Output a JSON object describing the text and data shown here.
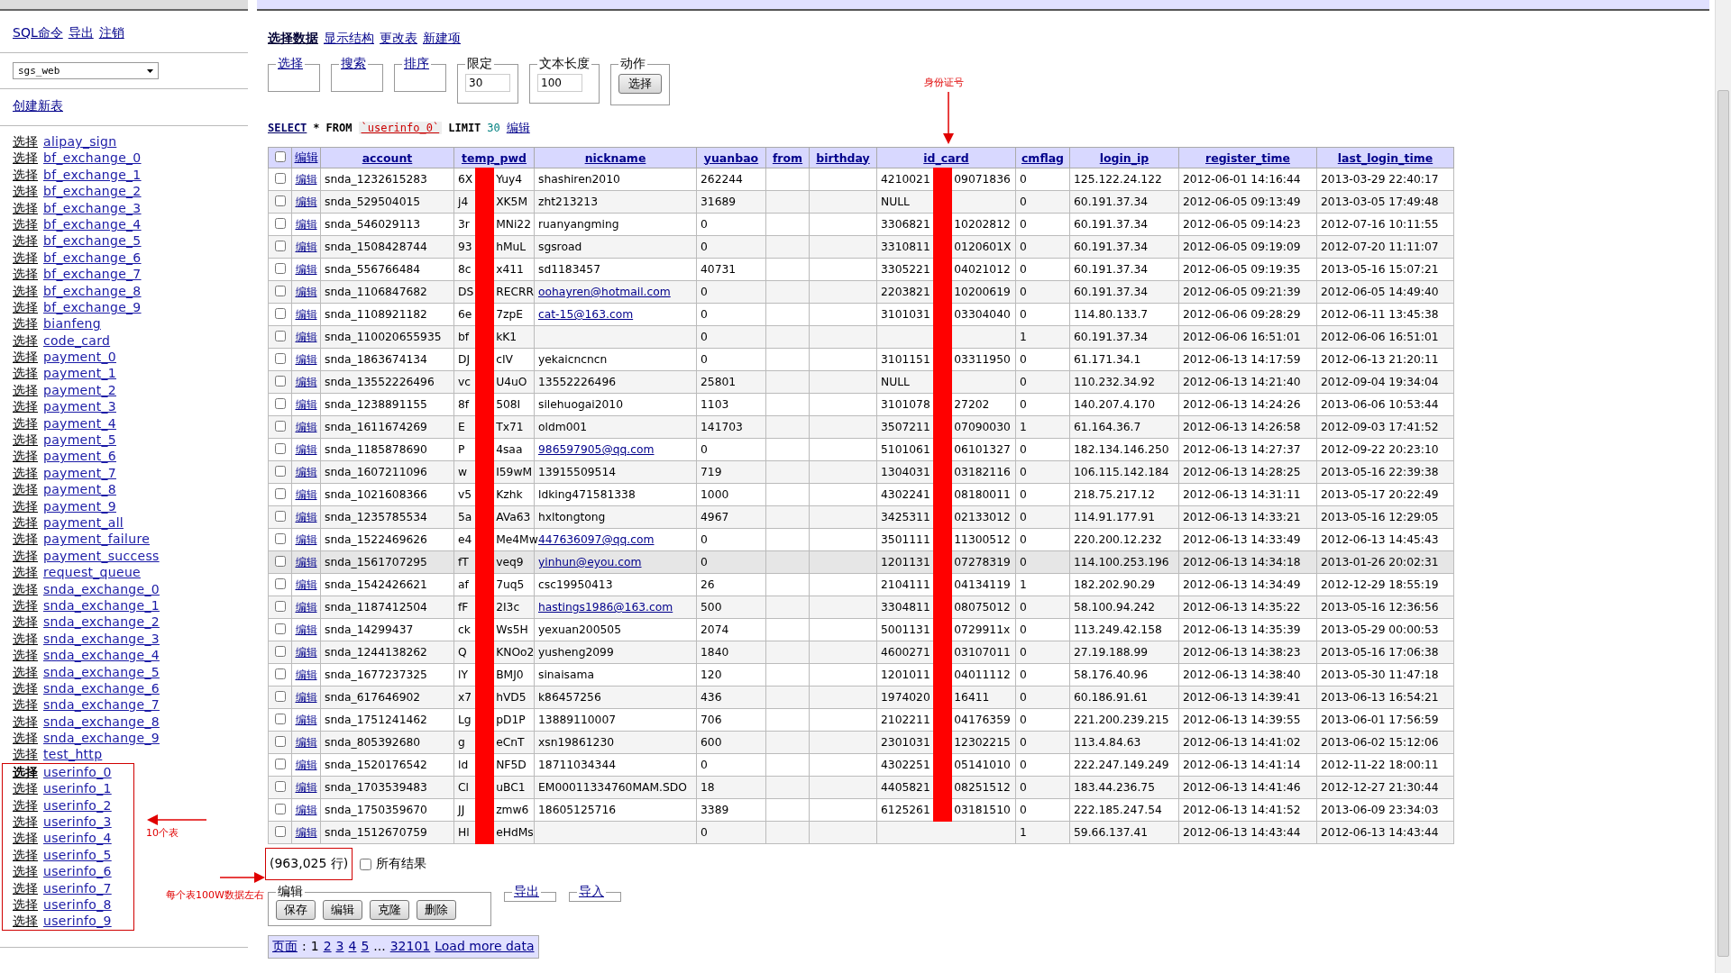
{
  "sidebar": {
    "top_links": [
      "SQL命令",
      "导出",
      "注销"
    ],
    "database": "sgs_web",
    "create_table": "创建新表",
    "items": [
      {
        "action": "选择",
        "name": "alipay_sign",
        "selected": false,
        "boxed": false
      },
      {
        "action": "选择",
        "name": "bf_exchange_0",
        "selected": false,
        "boxed": false
      },
      {
        "action": "选择",
        "name": "bf_exchange_1",
        "selected": false,
        "boxed": false
      },
      {
        "action": "选择",
        "name": "bf_exchange_2",
        "selected": false,
        "boxed": false
      },
      {
        "action": "选择",
        "name": "bf_exchange_3",
        "selected": false,
        "boxed": false
      },
      {
        "action": "选择",
        "name": "bf_exchange_4",
        "selected": false,
        "boxed": false
      },
      {
        "action": "选择",
        "name": "bf_exchange_5",
        "selected": false,
        "boxed": false
      },
      {
        "action": "选择",
        "name": "bf_exchange_6",
        "selected": false,
        "boxed": false
      },
      {
        "action": "选择",
        "name": "bf_exchange_7",
        "selected": false,
        "boxed": false
      },
      {
        "action": "选择",
        "name": "bf_exchange_8",
        "selected": false,
        "boxed": false
      },
      {
        "action": "选择",
        "name": "bf_exchange_9",
        "selected": false,
        "boxed": false
      },
      {
        "action": "选择",
        "name": "bianfeng",
        "selected": false,
        "boxed": false
      },
      {
        "action": "选择",
        "name": "code_card",
        "selected": false,
        "boxed": false
      },
      {
        "action": "选择",
        "name": "payment_0",
        "selected": false,
        "boxed": false
      },
      {
        "action": "选择",
        "name": "payment_1",
        "selected": false,
        "boxed": false
      },
      {
        "action": "选择",
        "name": "payment_2",
        "selected": false,
        "boxed": false
      },
      {
        "action": "选择",
        "name": "payment_3",
        "selected": false,
        "boxed": false
      },
      {
        "action": "选择",
        "name": "payment_4",
        "selected": false,
        "boxed": false
      },
      {
        "action": "选择",
        "name": "payment_5",
        "selected": false,
        "boxed": false
      },
      {
        "action": "选择",
        "name": "payment_6",
        "selected": false,
        "boxed": false
      },
      {
        "action": "选择",
        "name": "payment_7",
        "selected": false,
        "boxed": false
      },
      {
        "action": "选择",
        "name": "payment_8",
        "selected": false,
        "boxed": false
      },
      {
        "action": "选择",
        "name": "payment_9",
        "selected": false,
        "boxed": false
      },
      {
        "action": "选择",
        "name": "payment_all",
        "selected": false,
        "boxed": false
      },
      {
        "action": "选择",
        "name": "payment_failure",
        "selected": false,
        "boxed": false
      },
      {
        "action": "选择",
        "name": "payment_success",
        "selected": false,
        "boxed": false
      },
      {
        "action": "选择",
        "name": "request_queue",
        "selected": false,
        "boxed": false
      },
      {
        "action": "选择",
        "name": "snda_exchange_0",
        "selected": false,
        "boxed": false
      },
      {
        "action": "选择",
        "name": "snda_exchange_1",
        "selected": false,
        "boxed": false
      },
      {
        "action": "选择",
        "name": "snda_exchange_2",
        "selected": false,
        "boxed": false
      },
      {
        "action": "选择",
        "name": "snda_exchange_3",
        "selected": false,
        "boxed": false
      },
      {
        "action": "选择",
        "name": "snda_exchange_4",
        "selected": false,
        "boxed": false
      },
      {
        "action": "选择",
        "name": "snda_exchange_5",
        "selected": false,
        "boxed": false
      },
      {
        "action": "选择",
        "name": "snda_exchange_6",
        "selected": false,
        "boxed": false
      },
      {
        "action": "选择",
        "name": "snda_exchange_7",
        "selected": false,
        "boxed": false
      },
      {
        "action": "选择",
        "name": "snda_exchange_8",
        "selected": false,
        "boxed": false
      },
      {
        "action": "选择",
        "name": "snda_exchange_9",
        "selected": false,
        "boxed": false
      },
      {
        "action": "选择",
        "name": "test_http",
        "selected": false,
        "boxed": false
      },
      {
        "action": "选择",
        "name": "userinfo_0",
        "selected": true,
        "boxed": true
      },
      {
        "action": "选择",
        "name": "userinfo_1",
        "selected": false,
        "boxed": true
      },
      {
        "action": "选择",
        "name": "userinfo_2",
        "selected": false,
        "boxed": true
      },
      {
        "action": "选择",
        "name": "userinfo_3",
        "selected": false,
        "boxed": true
      },
      {
        "action": "选择",
        "name": "userinfo_4",
        "selected": false,
        "boxed": true
      },
      {
        "action": "选择",
        "name": "userinfo_5",
        "selected": false,
        "boxed": true
      },
      {
        "action": "选择",
        "name": "userinfo_6",
        "selected": false,
        "boxed": true
      },
      {
        "action": "选择",
        "name": "userinfo_7",
        "selected": false,
        "boxed": true
      },
      {
        "action": "选择",
        "name": "userinfo_8",
        "selected": false,
        "boxed": true
      },
      {
        "action": "选择",
        "name": "userinfo_9",
        "selected": false,
        "boxed": true
      }
    ]
  },
  "tabs": [
    {
      "label": "选择数据",
      "selected": true
    },
    {
      "label": "显示结构",
      "selected": false
    },
    {
      "label": "更改表",
      "selected": false
    },
    {
      "label": "新建项",
      "selected": false
    }
  ],
  "option_groups": [
    {
      "kind": "link",
      "legend": "选择"
    },
    {
      "kind": "link",
      "legend": "搜索"
    },
    {
      "kind": "link",
      "legend": "排序"
    },
    {
      "kind": "input",
      "legend": "限定",
      "value": "30"
    },
    {
      "kind": "input",
      "legend": "文本长度",
      "value": "100"
    },
    {
      "kind": "button",
      "legend": "动作",
      "button": "选择"
    }
  ],
  "sql": {
    "parts": [
      {
        "kind": "command",
        "text": "SELECT"
      },
      {
        "kind": "keyword",
        "text": "*"
      },
      {
        "kind": "keyword",
        "text": "FROM"
      },
      {
        "kind": "table",
        "text": "`userinfo_0`"
      },
      {
        "kind": "keyword",
        "text": "LIMIT"
      },
      {
        "kind": "number",
        "text": "30"
      }
    ],
    "edit": "编辑"
  },
  "table": {
    "select_all": {
      "checked": false
    },
    "edit_header": "编辑",
    "columns": [
      {
        "name": "account"
      },
      {
        "name": "temp_pwd"
      },
      {
        "name": "nickname"
      },
      {
        "name": "yuanbao"
      },
      {
        "name": "from"
      },
      {
        "name": "birthday"
      },
      {
        "name": "id_card"
      },
      {
        "name": "cmflag"
      },
      {
        "name": "login_ip"
      },
      {
        "name": "register_time"
      },
      {
        "name": "last_login_time"
      }
    ],
    "rows": [
      {
        "checked": false,
        "highlighted": false,
        "edit": "编辑",
        "cells": [
          "snda_1232615283",
          {
            "kind": "masked",
            "start": "6X",
            "end": "Yuy4"
          },
          "shashiren2010",
          "262244",
          null,
          null,
          {
            "kind": "masked",
            "start": "4210021",
            "end": "09071836"
          },
          "0",
          "125.122.24.122",
          "2012-06-01 14:16:44",
          "2013-03-29 22:40:17"
        ]
      },
      {
        "checked": false,
        "highlighted": false,
        "edit": "编辑",
        "cells": [
          "snda_529504015",
          {
            "kind": "masked",
            "start": "j4",
            "end": "XK5M"
          },
          "zht213213",
          "31689",
          null,
          null,
          {
            "kind": "masked",
            "start": "NULL"
          },
          "0",
          "60.191.37.34",
          "2012-06-05 09:13:49",
          "2013-03-05 17:49:48"
        ]
      },
      {
        "checked": false,
        "highlighted": false,
        "edit": "编辑",
        "cells": [
          "snda_546029113",
          {
            "kind": "masked",
            "start": "3r",
            "end": "MNi22"
          },
          "ruanyangming",
          "0",
          null,
          null,
          {
            "kind": "masked",
            "start": "3306821",
            "end": "10202812"
          },
          "0",
          "60.191.37.34",
          "2012-06-05 09:14:23",
          "2012-07-16 10:11:55"
        ]
      },
      {
        "checked": false,
        "highlighted": false,
        "edit": "编辑",
        "cells": [
          "snda_1508428744",
          {
            "kind": "masked",
            "start": "93",
            "end": "hMuL"
          },
          "sgsroad",
          "0",
          null,
          null,
          {
            "kind": "masked",
            "start": "3310811",
            "end": "0120601X"
          },
          "0",
          "60.191.37.34",
          "2012-06-05 09:19:09",
          "2012-07-20 11:11:07"
        ]
      },
      {
        "checked": false,
        "highlighted": false,
        "edit": "编辑",
        "cells": [
          "snda_556766484",
          {
            "kind": "masked",
            "start": "8c",
            "end": "x411"
          },
          "sd1183457",
          "40731",
          null,
          null,
          {
            "kind": "masked",
            "start": "3305221",
            "end": "04021012"
          },
          "0",
          "60.191.37.34",
          "2012-06-05 09:19:35",
          "2013-05-16 15:07:21"
        ]
      },
      {
        "checked": false,
        "highlighted": false,
        "edit": "编辑",
        "cells": [
          "snda_1106847682",
          {
            "kind": "masked",
            "start": "DS",
            "end": "RECRR"
          },
          {
            "kind": "link",
            "text": "oohayren@hotmail.com"
          },
          "0",
          null,
          null,
          {
            "kind": "masked",
            "start": "2203821",
            "end": "10200619"
          },
          "0",
          "60.191.37.34",
          "2012-06-05 09:21:39",
          "2012-06-05 14:49:40"
        ]
      },
      {
        "checked": false,
        "highlighted": false,
        "edit": "编辑",
        "cells": [
          "snda_1108921182",
          {
            "kind": "masked",
            "start": "6e",
            "end": "7zpE"
          },
          {
            "kind": "link",
            "text": "cat-15@163.com"
          },
          "0",
          null,
          null,
          {
            "kind": "masked",
            "start": "3101031",
            "end": "03304040"
          },
          "0",
          "114.80.133.7",
          "2012-06-06 09:28:29",
          "2012-06-11 13:45:38"
        ]
      },
      {
        "checked": false,
        "highlighted": false,
        "edit": "编辑",
        "cells": [
          "snda_110020655935",
          {
            "kind": "masked",
            "start": "bf",
            "end": "kK1"
          },
          null,
          "0",
          null,
          null,
          {
            "kind": "masked"
          },
          "1",
          "60.191.37.34",
          "2012-06-06 16:51:01",
          "2012-06-06 16:51:01"
        ]
      },
      {
        "checked": false,
        "highlighted": false,
        "edit": "编辑",
        "cells": [
          "snda_1863674134",
          {
            "kind": "masked",
            "start": "DJ",
            "end": "cIV"
          },
          "yekaicncncn",
          "0",
          null,
          null,
          {
            "kind": "masked",
            "start": "3101151",
            "end": "03311950"
          },
          "0",
          "61.171.34.1",
          "2012-06-13 14:17:59",
          "2012-06-13 21:20:11"
        ]
      },
      {
        "checked": false,
        "highlighted": false,
        "edit": "编辑",
        "cells": [
          "snda_13552226496",
          {
            "kind": "masked",
            "start": "vc",
            "end": "U4uO"
          },
          "13552226496",
          "25801",
          null,
          null,
          {
            "kind": "masked",
            "start": "NULL"
          },
          "0",
          "110.232.34.92",
          "2012-06-13 14:21:40",
          "2012-09-04 19:34:04"
        ]
      },
      {
        "checked": false,
        "highlighted": false,
        "edit": "编辑",
        "cells": [
          "snda_1238891155",
          {
            "kind": "masked",
            "start": "8f",
            "end": "508I"
          },
          "silehuogai2010",
          "1103",
          null,
          null,
          {
            "kind": "masked",
            "start": "3101078",
            "end": "27202"
          },
          "0",
          "140.207.4.170",
          "2012-06-13 14:24:26",
          "2013-06-06 10:53:44"
        ]
      },
      {
        "checked": false,
        "highlighted": false,
        "edit": "编辑",
        "cells": [
          "snda_1611674269",
          {
            "kind": "masked",
            "start": "E",
            "end": "Tx71"
          },
          "oldm001",
          "141703",
          null,
          null,
          {
            "kind": "masked",
            "start": "3507211",
            "end": "07090030"
          },
          "1",
          "61.164.36.7",
          "2012-06-13 14:26:58",
          "2012-09-03 17:41:52"
        ]
      },
      {
        "checked": false,
        "highlighted": false,
        "edit": "编辑",
        "cells": [
          "snda_1185878690",
          {
            "kind": "masked",
            "start": "P",
            "end": "4saa"
          },
          {
            "kind": "link",
            "text": "986597905@qq.com"
          },
          "0",
          null,
          null,
          {
            "kind": "masked",
            "start": "5101061",
            "end": "06101327"
          },
          "0",
          "182.134.146.250",
          "2012-06-13 14:27:37",
          "2012-09-22 20:23:10"
        ]
      },
      {
        "checked": false,
        "highlighted": false,
        "edit": "编辑",
        "cells": [
          "snda_1607211096",
          {
            "kind": "masked",
            "start": "w",
            "end": "I59wM"
          },
          "13915509514",
          "719",
          null,
          null,
          {
            "kind": "masked",
            "start": "1304031",
            "end": "03182116"
          },
          "0",
          "106.115.142.184",
          "2012-06-13 14:28:25",
          "2013-05-16 22:39:38"
        ]
      },
      {
        "checked": false,
        "highlighted": false,
        "edit": "编辑",
        "cells": [
          "snda_1021608366",
          {
            "kind": "masked",
            "start": "v5",
            "end": "Kzhk"
          },
          "ldking471581338",
          "1000",
          null,
          null,
          {
            "kind": "masked",
            "start": "4302241",
            "end": "08180011"
          },
          "0",
          "218.75.217.12",
          "2012-06-13 14:31:11",
          "2013-05-17 20:22:49"
        ]
      },
      {
        "checked": false,
        "highlighted": false,
        "edit": "编辑",
        "cells": [
          "snda_1235785534",
          {
            "kind": "masked",
            "start": "5a",
            "end": "AVa63"
          },
          "hxltongtong",
          "4967",
          null,
          null,
          {
            "kind": "masked",
            "start": "3425311",
            "end": "02133012"
          },
          "0",
          "114.91.177.91",
          "2012-06-13 14:33:21",
          "2013-05-16 12:29:05"
        ]
      },
      {
        "checked": false,
        "highlighted": false,
        "edit": "编辑",
        "cells": [
          "snda_1522469626",
          {
            "kind": "masked",
            "start": "e4",
            "end": "Me4Mw"
          },
          {
            "kind": "link",
            "text": "447636097@qq.com"
          },
          "0",
          null,
          null,
          {
            "kind": "masked",
            "start": "3501111",
            "end": "11300512"
          },
          "0",
          "220.200.12.232",
          "2012-06-13 14:33:49",
          "2012-06-13 14:45:43"
        ]
      },
      {
        "checked": false,
        "highlighted": true,
        "edit": "编辑",
        "cells": [
          "snda_1561707295",
          {
            "kind": "masked",
            "start": "fT",
            "end": "veq9"
          },
          {
            "kind": "link",
            "text": "yinhun@eyou.com"
          },
          "0",
          null,
          null,
          {
            "kind": "masked",
            "start": "1201131",
            "end": "07278319"
          },
          "0",
          "114.100.253.196",
          "2012-06-13 14:34:18",
          "2013-01-26 20:02:31"
        ]
      },
      {
        "checked": false,
        "highlighted": false,
        "edit": "编辑",
        "cells": [
          "snda_1542426621",
          {
            "kind": "masked",
            "start": "af",
            "end": "7uq5"
          },
          "csc19950413",
          "26",
          null,
          null,
          {
            "kind": "masked",
            "start": "2104111",
            "end": "04134119"
          },
          "1",
          "182.202.90.29",
          "2012-06-13 14:34:49",
          "2012-12-29 18:55:19"
        ]
      },
      {
        "checked": false,
        "highlighted": false,
        "edit": "编辑",
        "cells": [
          "snda_1187412504",
          {
            "kind": "masked",
            "start": "fF",
            "end": "2I3c"
          },
          {
            "kind": "link",
            "text": "hastings1986@163.com"
          },
          "500",
          null,
          null,
          {
            "kind": "masked",
            "start": "3304811",
            "end": "08075012"
          },
          "0",
          "58.100.94.242",
          "2012-06-13 14:35:22",
          "2013-05-16 12:36:56"
        ]
      },
      {
        "checked": false,
        "highlighted": false,
        "edit": "编辑",
        "cells": [
          "snda_14299437",
          {
            "kind": "masked",
            "start": "ck",
            "end": "Ws5H"
          },
          "yexuan200505",
          "2074",
          null,
          null,
          {
            "kind": "masked",
            "start": "5001131",
            "end": "0729911x"
          },
          "0",
          "113.249.42.158",
          "2012-06-13 14:35:39",
          "2013-05-29 00:00:53"
        ]
      },
      {
        "checked": false,
        "highlighted": false,
        "edit": "编辑",
        "cells": [
          "snda_1244138262",
          {
            "kind": "masked",
            "start": "Q",
            "end": "KNOo2"
          },
          "yusheng2099",
          "1840",
          null,
          null,
          {
            "kind": "masked",
            "start": "4600271",
            "end": "03107011"
          },
          "0",
          "27.19.188.99",
          "2012-06-13 14:38:23",
          "2013-05-16 17:06:38"
        ]
      },
      {
        "checked": false,
        "highlighted": false,
        "edit": "编辑",
        "cells": [
          "snda_1677237325",
          {
            "kind": "masked",
            "start": "lY",
            "end": "BMJ0"
          },
          "sinaisama",
          "120",
          null,
          null,
          {
            "kind": "masked",
            "start": "1201011",
            "end": "04011112"
          },
          "0",
          "58.176.40.96",
          "2012-06-13 14:38:40",
          "2013-05-30 11:47:18"
        ]
      },
      {
        "checked": false,
        "highlighted": false,
        "edit": "编辑",
        "cells": [
          "snda_617646902",
          {
            "kind": "masked",
            "start": "x7",
            "end": "hVD5"
          },
          "k86457256",
          "436",
          null,
          null,
          {
            "kind": "masked",
            "start": "1974020",
            "end": "16411"
          },
          "0",
          "60.186.91.61",
          "2012-06-13 14:39:41",
          "2013-06-13 16:54:21"
        ]
      },
      {
        "checked": false,
        "highlighted": false,
        "edit": "编辑",
        "cells": [
          "snda_1751241462",
          {
            "kind": "masked",
            "start": "Lg",
            "end": "pD1P"
          },
          "13889110007",
          "706",
          null,
          null,
          {
            "kind": "masked",
            "start": "2102211",
            "end": "04176359"
          },
          "0",
          "221.200.239.215",
          "2012-06-13 14:39:55",
          "2013-06-01 17:56:59"
        ]
      },
      {
        "checked": false,
        "highlighted": false,
        "edit": "编辑",
        "cells": [
          "snda_805392680",
          {
            "kind": "masked",
            "start": "g",
            "end": "eCnT"
          },
          "xsn19861230",
          "600",
          null,
          null,
          {
            "kind": "masked",
            "start": "2301031",
            "end": "12302215"
          },
          "0",
          "113.4.84.63",
          "2012-06-13 14:41:02",
          "2013-06-02 15:12:06"
        ]
      },
      {
        "checked": false,
        "highlighted": false,
        "edit": "编辑",
        "cells": [
          "snda_1520176542",
          {
            "kind": "masked",
            "start": "ld",
            "end": "NF5D"
          },
          "18711034344",
          "0",
          null,
          null,
          {
            "kind": "masked",
            "start": "4302251",
            "end": "05141010"
          },
          "0",
          "222.247.149.249",
          "2012-06-13 14:41:14",
          "2012-11-22 18:00:11"
        ]
      },
      {
        "checked": false,
        "highlighted": false,
        "edit": "编辑",
        "cells": [
          "snda_1703539483",
          {
            "kind": "masked",
            "start": "Cl",
            "end": "uBC1"
          },
          "EM00011334760MAM.SDO",
          "18",
          null,
          null,
          {
            "kind": "masked",
            "start": "4405821",
            "end": "08251512"
          },
          "0",
          "183.44.236.75",
          "2012-06-13 14:41:46",
          "2012-12-27 21:30:44"
        ]
      },
      {
        "checked": false,
        "highlighted": false,
        "edit": "编辑",
        "cells": [
          "snda_1750359670",
          {
            "kind": "masked",
            "start": "JJ",
            "end": "zmw6"
          },
          "18605125716",
          "3389",
          null,
          null,
          {
            "kind": "masked",
            "start": "6125261",
            "end": "03181510"
          },
          "0",
          "222.185.247.54",
          "2012-06-13 14:41:52",
          "2013-06-09 23:34:03"
        ]
      },
      {
        "checked": false,
        "highlighted": false,
        "edit": "编辑",
        "cells": [
          "snda_1512670759",
          {
            "kind": "masked",
            "start": "Hl",
            "end": "eHdMs"
          },
          null,
          "0",
          null,
          null,
          null,
          "1",
          "59.66.137.41",
          "2012-06-13 14:43:44",
          "2012-06-13 14:43:44"
        ]
      }
    ]
  },
  "row_count": {
    "text": "(963,025 行)",
    "boxed": true
  },
  "all_results": {
    "label": "所有结果",
    "checked": false
  },
  "edit_group": {
    "legend": "编辑",
    "buttons": [
      "保存",
      "编辑",
      "克隆",
      "删除"
    ]
  },
  "transfer_links": [
    "导出",
    "导入"
  ],
  "pager": {
    "label": "页面",
    "separator": ":",
    "pages": [
      {
        "label": "1",
        "selected": true
      },
      {
        "label": "2",
        "selected": false
      },
      {
        "label": "3",
        "selected": false
      },
      {
        "label": "4",
        "selected": false
      },
      {
        "label": "5",
        "selected": false
      }
    ],
    "ellipsis": "...",
    "last": "32101",
    "more": "Load more data"
  },
  "annotations": [
    {
      "text": "身份证号"
    },
    {
      "text": "10个表"
    },
    {
      "text": "每个表100W数据左右"
    }
  ]
}
